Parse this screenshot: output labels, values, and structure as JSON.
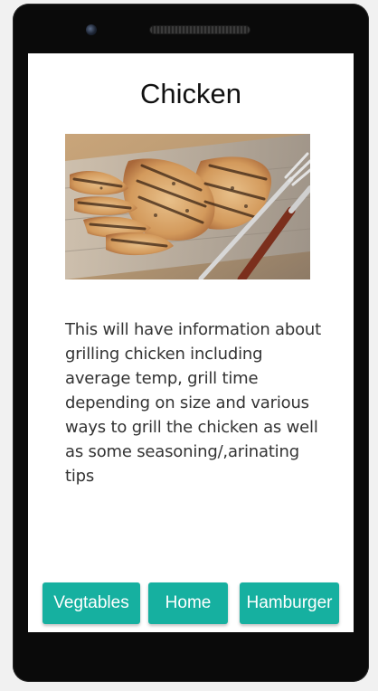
{
  "page": {
    "title": "Chicken",
    "description": "This will have information about grilling chicken including average temp, grill time depending on size and various ways to grill the chicken as well as some seasoning/,arinating tips",
    "image_icon": "grilled-chicken-photo"
  },
  "nav": {
    "buttons": [
      {
        "label": "Vegtables",
        "icon": "none"
      },
      {
        "label": "Home",
        "icon": "none"
      },
      {
        "label": "Hamburger",
        "icon": "none"
      }
    ]
  },
  "colors": {
    "accent": "#16b0a0",
    "device": "#0a0a0a",
    "screen": "#ffffff"
  }
}
